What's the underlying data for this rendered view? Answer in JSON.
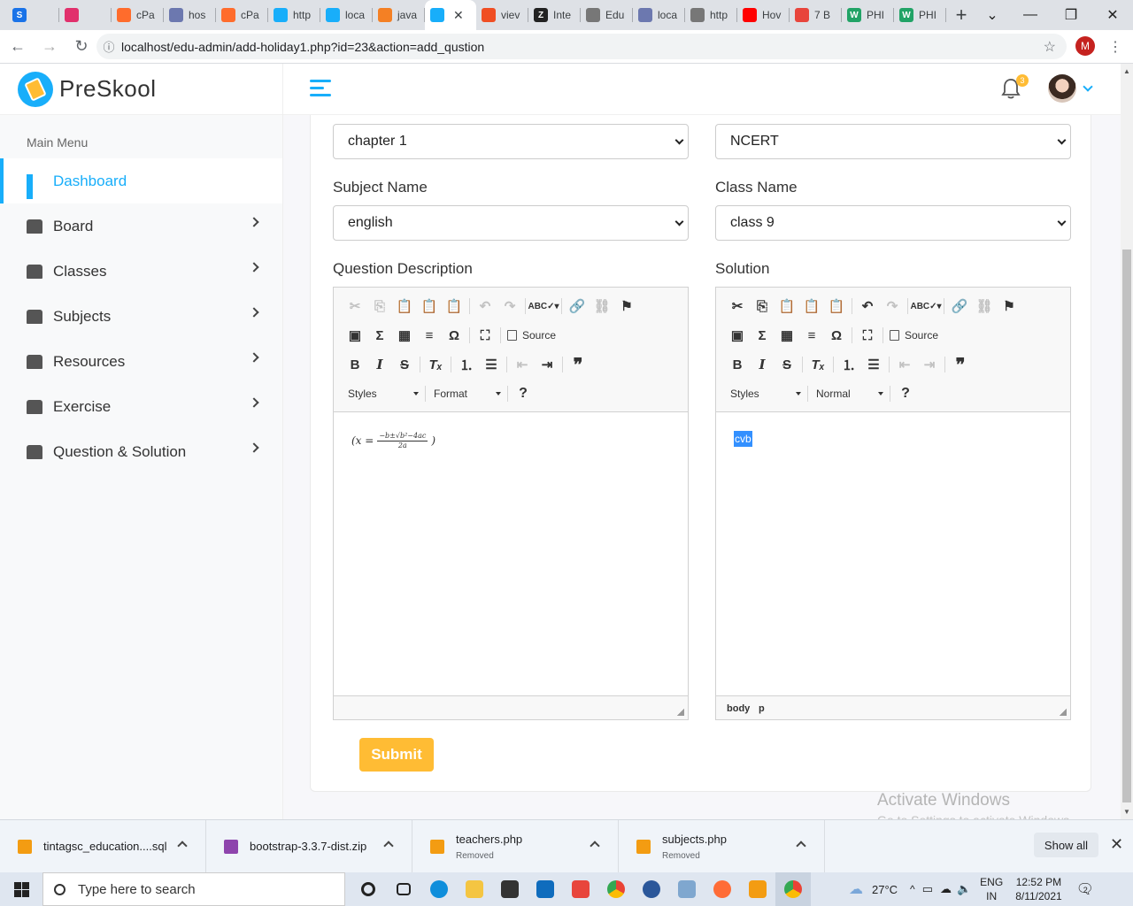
{
  "browser": {
    "tabs": [
      {
        "label": "",
        "color": "#1a73e8",
        "glyph": "S"
      },
      {
        "label": "",
        "color": "#e1306c",
        "glyph": ""
      },
      {
        "label": "cPa",
        "color": "#ff6c2c",
        "glyph": ""
      },
      {
        "label": "hos",
        "color": "#6c78af",
        "glyph": ""
      },
      {
        "label": "cPa",
        "color": "#ff6c2c",
        "glyph": ""
      },
      {
        "label": "http",
        "color": "#18aefa",
        "glyph": ""
      },
      {
        "label": "loca",
        "color": "#18aefa",
        "glyph": ""
      },
      {
        "label": "java",
        "color": "#f48024",
        "glyph": ""
      },
      {
        "label": "",
        "color": "#18aefa",
        "glyph": "",
        "active": true
      },
      {
        "label": "viev",
        "color": "#f04e23",
        "glyph": ""
      },
      {
        "label": "Inte",
        "color": "#222222",
        "glyph": "Z"
      },
      {
        "label": "Edu",
        "color": "#777777",
        "glyph": ""
      },
      {
        "label": "loca",
        "color": "#6c78af",
        "glyph": ""
      },
      {
        "label": "http",
        "color": "#777777",
        "glyph": ""
      },
      {
        "label": "Hov",
        "color": "#ff0000",
        "glyph": ""
      },
      {
        "label": "7 B",
        "color": "#e8453c",
        "glyph": ""
      },
      {
        "label": "PHI",
        "color": "#21a366",
        "glyph": "W"
      },
      {
        "label": "PHI",
        "color": "#21a366",
        "glyph": "W"
      }
    ],
    "url": "localhost/edu-admin/add-holiday1.php?id=23&action=add_qustion",
    "profile_initial": "M"
  },
  "app": {
    "brand": "PreSkool",
    "notification_count": "3",
    "menu_title": "Main Menu",
    "menu": [
      {
        "label": "Dashboard",
        "active": true
      },
      {
        "label": "Board"
      },
      {
        "label": "Classes"
      },
      {
        "label": "Subjects"
      },
      {
        "label": "Resources"
      },
      {
        "label": "Exercise"
      },
      {
        "label": "Question & Solution"
      }
    ]
  },
  "form": {
    "chapter_value": "chapter 1",
    "board_value": "NCERT",
    "subject_label": "Subject Name",
    "subject_value": "english",
    "class_label": "Class Name",
    "class_value": "class 9",
    "question_label": "Question Description",
    "solution_label": "Solution",
    "question_content": "(x = −b±√(b²−4ac) / 2a)",
    "math_lhs": "(x =",
    "math_num": "−b±√b²−4ac",
    "math_den": "2a",
    "math_rhs": ")",
    "solution_content": "cvb",
    "editor_source_label": "Source",
    "styles_label": "Styles",
    "format_label_q": "Format",
    "format_label_s": "Normal",
    "help_label": "?",
    "footer_path_body": "body",
    "footer_path_p": "p",
    "submit_label": "Submit"
  },
  "watermark": {
    "line1": "Activate Windows",
    "line2": "Go to Settings to activate Windows."
  },
  "downloads": {
    "items": [
      {
        "name": "tintagsc_education....sql",
        "sub": "",
        "color": "#f39c12"
      },
      {
        "name": "bootstrap-3.3.7-dist.zip",
        "sub": "",
        "color": "#8e44ad"
      },
      {
        "name": "teachers.php",
        "sub": "Removed",
        "color": "#f39c12"
      },
      {
        "name": "subjects.php",
        "sub": "Removed",
        "color": "#f39c12"
      }
    ],
    "show_all": "Show all"
  },
  "taskbar": {
    "search_placeholder": "Type here to search",
    "temperature": "27°C",
    "language": "ENG",
    "region": "IN",
    "time": "12:52 PM",
    "date": "8/11/2021",
    "notification_count": "2"
  }
}
